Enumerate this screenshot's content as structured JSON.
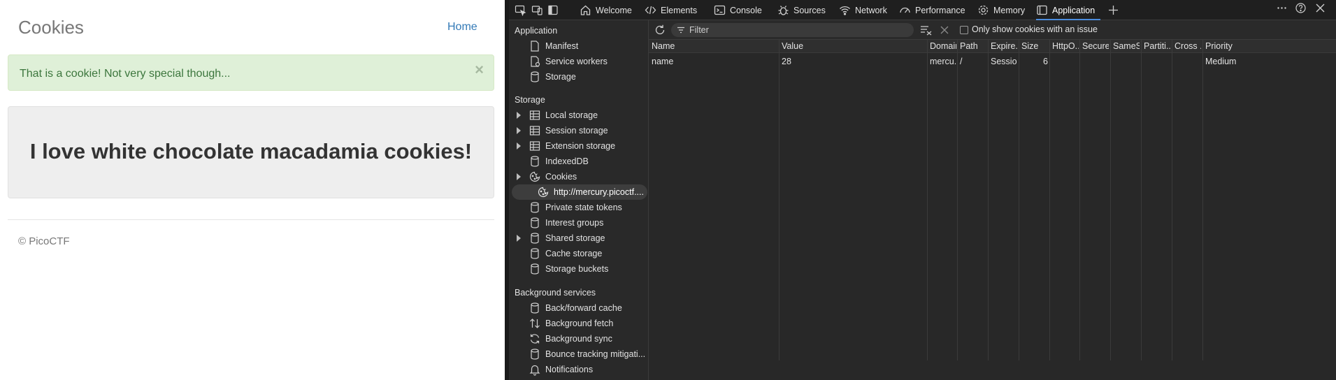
{
  "site": {
    "brand": "Cookies",
    "nav_home": "Home",
    "alert_message": "That is a cookie! Not very special though...",
    "alert_close": "×",
    "jumbotron_heading": "I love white chocolate macadamia cookies!",
    "footer": "© PicoCTF"
  },
  "devtools": {
    "tabs": [
      {
        "label": "Welcome",
        "icon": "home-icon"
      },
      {
        "label": "Elements",
        "icon": "code-icon"
      },
      {
        "label": "Console",
        "icon": "console-icon"
      },
      {
        "label": "Sources",
        "icon": "bug-icon"
      },
      {
        "label": "Network",
        "icon": "wifi-icon"
      },
      {
        "label": "Performance",
        "icon": "gauge-icon"
      },
      {
        "label": "Memory",
        "icon": "gear-icon"
      },
      {
        "label": "Application",
        "icon": "application-icon",
        "active": true
      }
    ],
    "sidebar": {
      "application_header": "Application",
      "application_items": [
        "Manifest",
        "Service workers",
        "Storage"
      ],
      "storage_header": "Storage",
      "storage_items": [
        "Local storage",
        "Session storage",
        "Extension storage",
        "IndexedDB",
        "Cookies"
      ],
      "cookie_origin": "http://mercury.picoctf....",
      "storage_items_after": [
        "Private state tokens",
        "Interest groups",
        "Shared storage",
        "Cache storage",
        "Storage buckets"
      ],
      "background_header": "Background services",
      "background_items": [
        "Back/forward cache",
        "Background fetch",
        "Background sync",
        "Bounce tracking mitigati...",
        "Notifications"
      ]
    },
    "toolbar": {
      "filter_placeholder": "Filter",
      "only_issues_label": "Only show cookies with an issue"
    },
    "table": {
      "columns": [
        "Name",
        "Value",
        "Domain",
        "Path",
        "Expire...",
        "Size",
        "HttpO...",
        "Secure",
        "SameS...",
        "Partiti...",
        "Cross ...",
        "Priority"
      ],
      "rows": [
        [
          "name",
          "28",
          "mercu...",
          "/",
          "Session",
          "6",
          "",
          "",
          "",
          "",
          "",
          "Medium"
        ]
      ]
    }
  }
}
